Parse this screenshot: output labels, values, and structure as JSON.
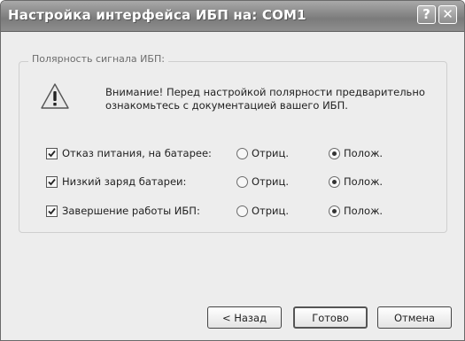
{
  "window": {
    "title": "Настройка интерфейса ИБП на: COM1",
    "help_glyph": "?",
    "close_glyph": "✕"
  },
  "group": {
    "legend": "Полярность сигнала ИБП:",
    "warning_text": "Внимание! Перед настройкой полярности предварительно ознакомьтесь с документацией вашего ИБП.",
    "warning_icon": "warning-icon",
    "rows": [
      {
        "label": "Отказ питания, на батарее:",
        "checked": true,
        "negative_label": "Отриц.",
        "positive_label": "Полож.",
        "selected": "positive"
      },
      {
        "label": "Низкий заряд батареи:",
        "checked": true,
        "negative_label": "Отриц.",
        "positive_label": "Полож.",
        "selected": "positive"
      },
      {
        "label": "Завершение работы ИБП:",
        "checked": true,
        "negative_label": "Отриц.",
        "positive_label": "Полож.",
        "selected": "positive"
      }
    ]
  },
  "buttons": {
    "back": "< Назад",
    "done": "Готово",
    "cancel": "Отмена"
  },
  "colors": {
    "titlebar": "#8a8a8a",
    "dialog_bg": "#ededed"
  }
}
